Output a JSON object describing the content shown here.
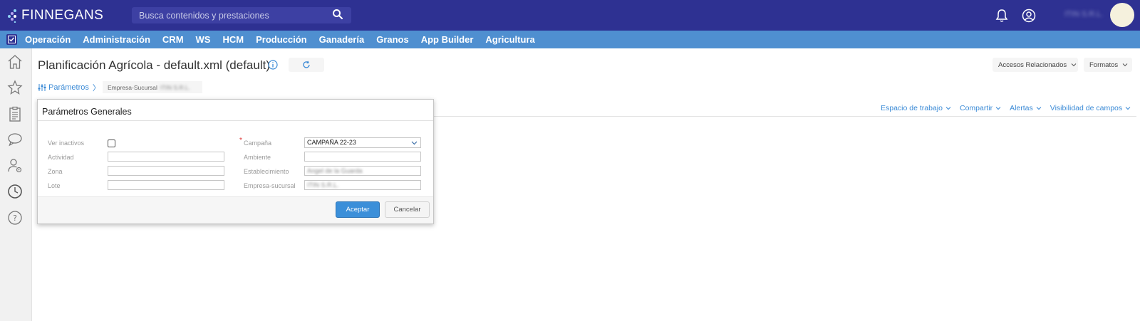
{
  "app": {
    "brand": "FINNEGANS"
  },
  "search": {
    "placeholder": "Busca contenidos y prestaciones"
  },
  "user": {
    "name": "ITIN S.R.L."
  },
  "menu": [
    "Operación",
    "Administración",
    "CRM",
    "WS",
    "HCM",
    "Producción",
    "Ganadería",
    "Granos",
    "App Builder",
    "Agricultura"
  ],
  "page": {
    "title": "Planificación Agrícola - default.xml (default)",
    "params_label": "Parámetros",
    "breadcrumb_label": "Empresa-Sucursal",
    "breadcrumb_value": "ITIN S.R.L.",
    "related_label": "Accesos Relacionados",
    "formats_label": "Formatos",
    "actions": [
      "Espacio de trabajo",
      "Compartir",
      "Alertas",
      "Visibilidad de campos"
    ]
  },
  "modal": {
    "title": "Parámetros Generales",
    "fields": {
      "ver_inactivos": {
        "label": "Ver inactivos",
        "checked": false
      },
      "actividad": {
        "label": "Actividad",
        "value": ""
      },
      "zona": {
        "label": "Zona",
        "value": ""
      },
      "lote": {
        "label": "Lote",
        "value": ""
      },
      "campana": {
        "label": "Campaña",
        "value": "CAMPAÑA 22-23",
        "required": true
      },
      "ambiente": {
        "label": "Ambiente",
        "value": ""
      },
      "establecimiento": {
        "label": "Establecimiento",
        "value": "Angel de la Guarda"
      },
      "empresa_sucursal": {
        "label": "Empresa-sucursal",
        "value": "ITIN S.R.L."
      }
    },
    "accept_label": "Aceptar",
    "cancel_label": "Cancelar"
  },
  "colors": {
    "topbar": "#2e3192",
    "menubar": "#4f8fd0",
    "link": "#3a8ad6",
    "primary_button": "#3b8fd9"
  }
}
